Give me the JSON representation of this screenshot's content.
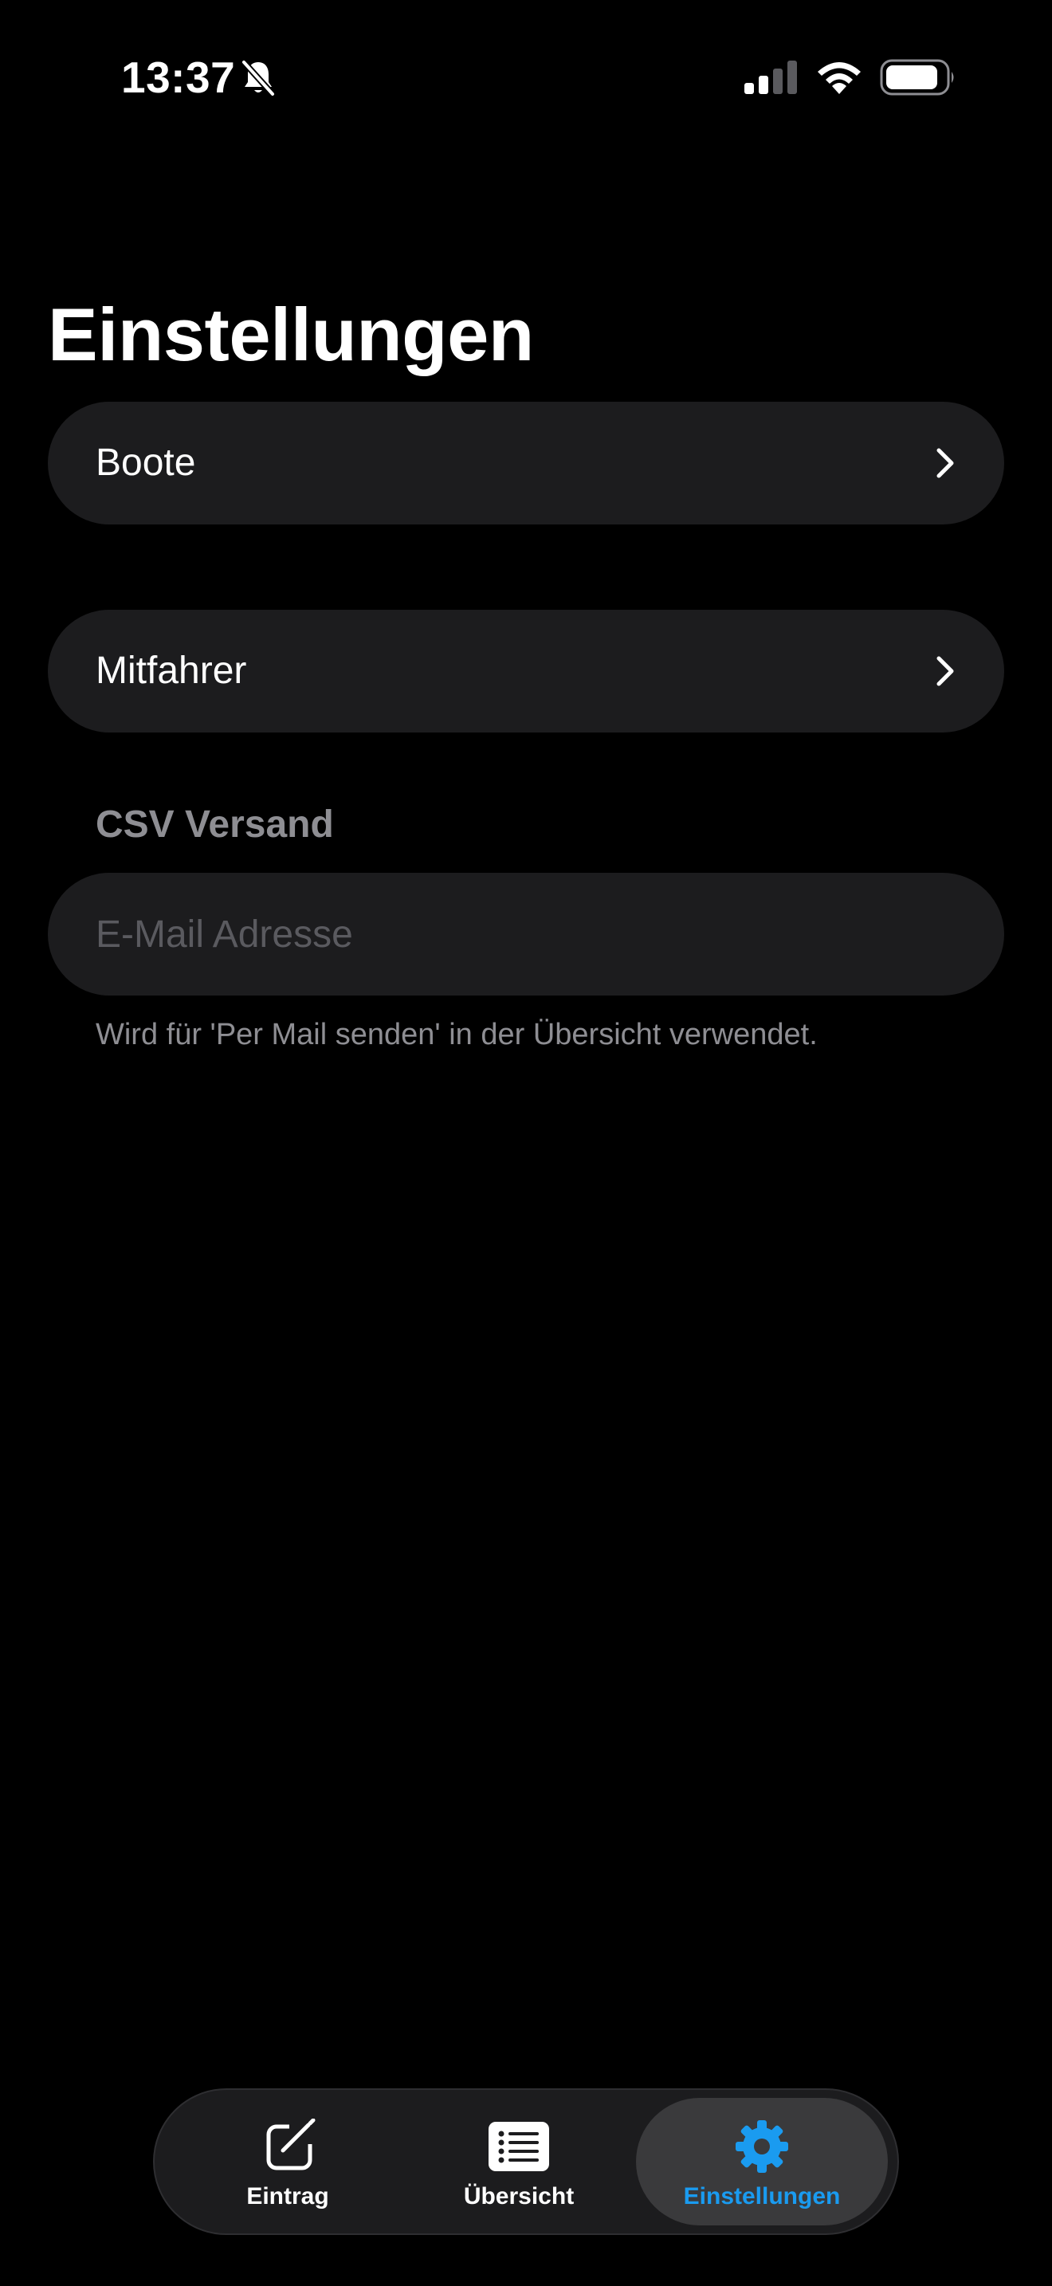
{
  "status_bar": {
    "time": "13:37",
    "icons": [
      "bell-slash-icon",
      "cellular-signal-icon",
      "wifi-icon",
      "battery-icon"
    ]
  },
  "header": {
    "title": "Einstellungen"
  },
  "settings": {
    "rows": [
      {
        "label": "Boote",
        "icon": "chevron-right-icon"
      },
      {
        "label": "Mitfahrer",
        "icon": "chevron-right-icon"
      }
    ],
    "csv_section": {
      "header": "CSV Versand",
      "email_value": "",
      "email_placeholder": "E-Mail Adresse",
      "footer": "Wird für 'Per Mail senden' in der Übersicht verwendet."
    }
  },
  "tab_bar": {
    "tabs": [
      {
        "label": "Eintrag",
        "icon": "compose-icon",
        "selected": false
      },
      {
        "label": "Übersicht",
        "icon": "list-icon",
        "selected": false
      },
      {
        "label": "Einstellungen",
        "icon": "gear-icon",
        "selected": true
      }
    ]
  },
  "colors": {
    "background": "#000000",
    "row_background": "#1c1c1e",
    "secondary_text": "#8e8e93",
    "accent": "#1a9bf0",
    "selected_tab_background": "#3a3a3c"
  }
}
